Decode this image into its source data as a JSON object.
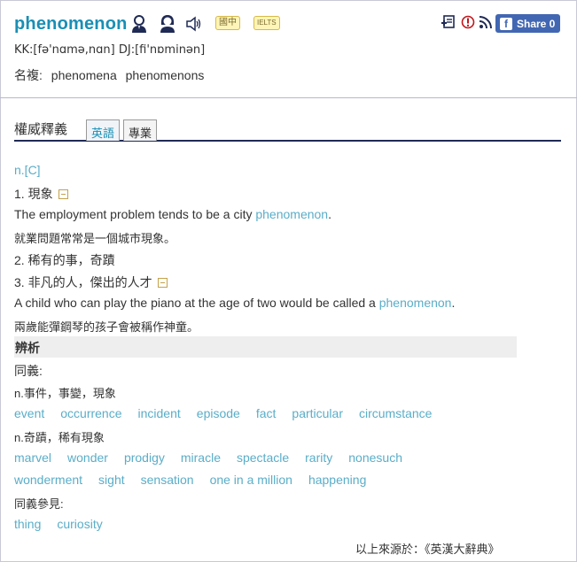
{
  "header": {
    "word": "phenomenon",
    "tags": [
      "國中",
      "IELTS"
    ],
    "pronunciation": "KK:[fə'nɑmə,nɑn] DJ:[fi'nɒminən]",
    "plural_label": "名複:",
    "plurals": [
      "phenomena",
      "phenomenons"
    ],
    "share_label": "Share 0"
  },
  "tabs": {
    "title": "權威釋義",
    "items": [
      {
        "label": "英語"
      },
      {
        "label": "專業"
      }
    ]
  },
  "entry": {
    "pos": "n.[C]",
    "sense1": {
      "label": "1. 現象",
      "example_pre": "The employment problem tends to be a city ",
      "example_link": "phenomenon",
      "example_post": ".",
      "translation": "就業問題常常是一個城市現象。"
    },
    "sense2": {
      "label": "2. 稀有的事，奇蹟"
    },
    "sense3": {
      "label": "3. 非凡的人，傑出的人才",
      "example_pre": "A child who can play the piano at the age of two would be called a ",
      "example_link": "phenomenon",
      "example_post": ".",
      "translation": "兩歲能彈鋼琴的孩子會被稱作神童。"
    }
  },
  "analysis": {
    "heading": "辨析",
    "synonyms_label": "同義:",
    "group1_label": "n.事件，事變，現象",
    "group1": [
      "event",
      "occurrence",
      "incident",
      "episode",
      "fact",
      "particular",
      "circumstance"
    ],
    "group2_label": "n.奇蹟，稀有現象",
    "group2_row1": [
      "marvel",
      "wonder",
      "prodigy",
      "miracle",
      "spectacle",
      "rarity",
      "nonesuch"
    ],
    "group2_row2": [
      "wonderment",
      "sight",
      "sensation",
      "one in a million",
      "happening"
    ],
    "see_also_label": "同義參見:",
    "see_also": [
      "thing",
      "curiosity"
    ]
  },
  "source": "以上來源於：《英漢大辭典》",
  "colors": {
    "link": "#5aadc8",
    "title": "#1a8fb5",
    "share": "#4267b2"
  }
}
